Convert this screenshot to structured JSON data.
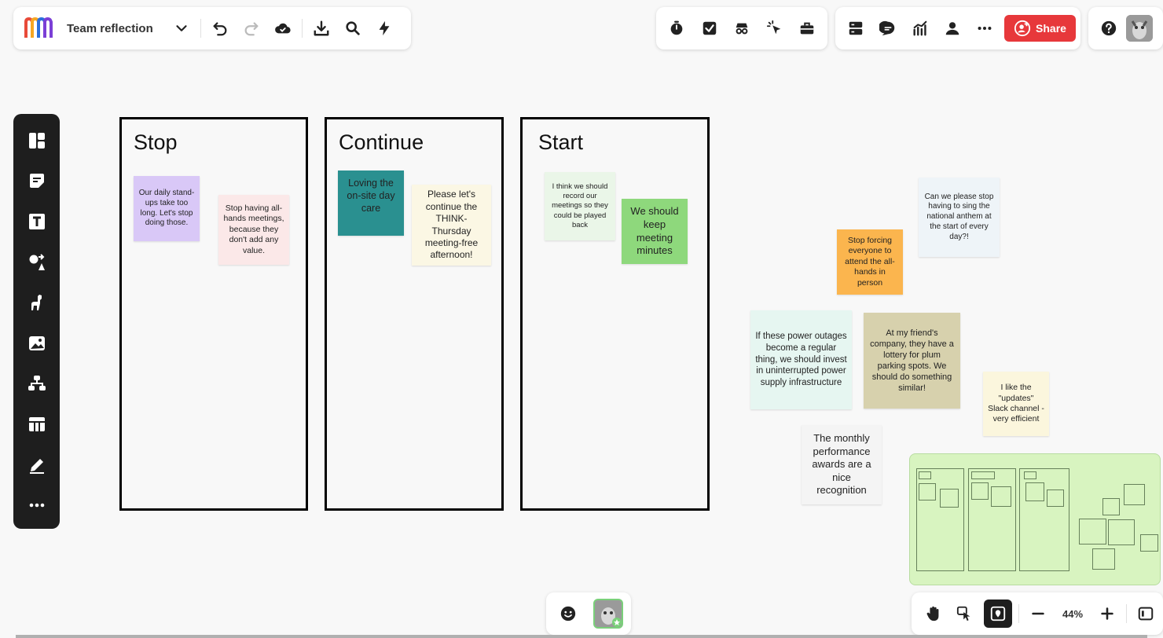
{
  "board": {
    "title": "Team reflection"
  },
  "toolbar": {
    "share_label": "Share",
    "zoom_level": "44%"
  },
  "frames": [
    {
      "title": "Stop"
    },
    {
      "title": "Continue"
    },
    {
      "title": "Start"
    }
  ],
  "stickies": [
    {
      "text": "Our daily stand-ups take too long. Let's stop doing those.",
      "color": "#d9c8f7"
    },
    {
      "text": "Stop having all-hands meetings, because they don't add any value.",
      "color": "#fbe8e8"
    },
    {
      "text": "Loving the on-site day care",
      "color": "#2a9090"
    },
    {
      "text": "Please let's continue the THINK-Thursday meeting-free afternoon!",
      "color": "#fbf7e4"
    },
    {
      "text": "I think we should record our meetings so they could be played back",
      "color": "#eaf6e8"
    },
    {
      "text": "We should keep meeting minutes",
      "color": "#8ed87c"
    },
    {
      "text": "Can we please stop having to sing the national anthem at the start of every day?!",
      "color": "#eef4f8"
    },
    {
      "text": "Stop forcing everyone to attend the all-hands in person",
      "color": "#fbb54e"
    },
    {
      "text": "If these power outages become a regular thing, we should invest in uninterrupted power supply infrastructure",
      "color": "#e6f6f1"
    },
    {
      "text": "At my friend's company, they have a lottery for plum parking spots.  We should do something similar!",
      "color": "#d7d1ad"
    },
    {
      "text": "I like the \"updates\" Slack channel - very efficient",
      "color": "#fbf6dd"
    },
    {
      "text": "The monthly performance awards are a nice recognition",
      "color": "#f4f4f4"
    }
  ],
  "colors": {
    "share_button": "#e7383b",
    "sidebar_bg": "#1e1e1e",
    "minimap_bg": "#d8f4c0"
  },
  "icons": {
    "logo": "miro-logo-icon",
    "chevron": "chevron-down-icon",
    "undo": "undo-icon",
    "redo": "redo-icon",
    "cloud": "cloud-sync-icon",
    "download": "download-icon",
    "search": "search-icon",
    "lightning": "lightning-icon"
  }
}
